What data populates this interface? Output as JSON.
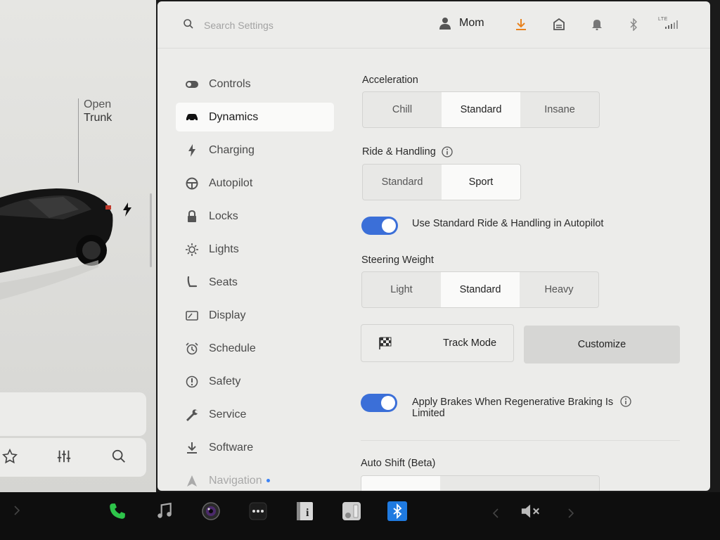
{
  "left": {
    "trunk_line1": "Open",
    "trunk_line2": "Trunk"
  },
  "topbar": {
    "search_placeholder": "Search Settings",
    "user_name": "Mom",
    "signal_label": "LTE",
    "download_color": "#e8821e"
  },
  "nav": {
    "items": [
      {
        "label": "Controls",
        "icon": "toggle-icon"
      },
      {
        "label": "Dynamics",
        "icon": "car-icon",
        "active": true
      },
      {
        "label": "Charging",
        "icon": "bolt-icon"
      },
      {
        "label": "Autopilot",
        "icon": "steering-wheel-icon"
      },
      {
        "label": "Locks",
        "icon": "lock-icon"
      },
      {
        "label": "Lights",
        "icon": "sun-icon"
      },
      {
        "label": "Seats",
        "icon": "seat-icon"
      },
      {
        "label": "Display",
        "icon": "display-icon"
      },
      {
        "label": "Schedule",
        "icon": "alarm-clock-icon"
      },
      {
        "label": "Safety",
        "icon": "alert-icon"
      },
      {
        "label": "Service",
        "icon": "wrench-icon"
      },
      {
        "label": "Software",
        "icon": "download-icon"
      },
      {
        "label": "Navigation",
        "icon": "navigation-arrow-icon"
      }
    ]
  },
  "dynamics": {
    "acceleration": {
      "label": "Acceleration",
      "options": [
        "Chill",
        "Standard",
        "Insane"
      ],
      "selected": "Standard"
    },
    "ride_handling": {
      "label": "Ride & Handling",
      "options": [
        "Standard",
        "Sport"
      ],
      "selected": "Sport"
    },
    "autopilot_ride_toggle": {
      "label": "Use Standard Ride & Handling in Autopilot",
      "on": true
    },
    "steering_weight": {
      "label": "Steering Weight",
      "options": [
        "Light",
        "Standard",
        "Heavy"
      ],
      "selected": "Standard"
    },
    "track_mode": {
      "label": "Track Mode",
      "customize_label": "Customize"
    },
    "apply_brakes_toggle": {
      "label_line1": "Apply Brakes When Regenerative Braking Is",
      "label_line2": "Limited",
      "on": true
    },
    "auto_shift": {
      "label": "Auto Shift (Beta)"
    }
  },
  "colors": {
    "accent_blue": "#3b6fd8",
    "phone_green": "#2ec44a",
    "bluetooth_blue": "#1f7ae0"
  }
}
